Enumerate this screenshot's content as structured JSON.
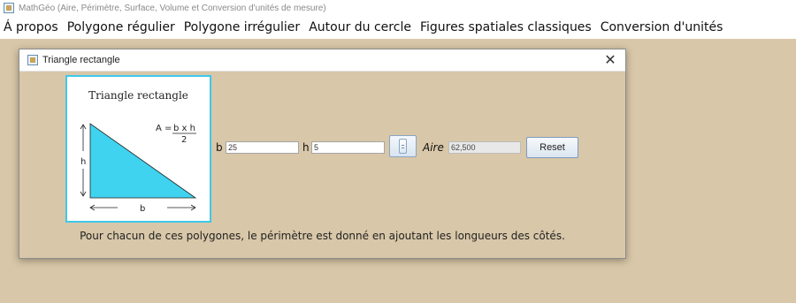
{
  "app": {
    "title": "MathGéo (Aire, Périmètre, Surface, Volume et Conversion d'unités de mesure)"
  },
  "menu": [
    {
      "label": "Á propos"
    },
    {
      "label": "Polygone régulier"
    },
    {
      "label": "Polygone irrégulier"
    },
    {
      "label": "Autour du cercle"
    },
    {
      "label": "Figures spatiales classiques"
    },
    {
      "label": "Conversion d'unités"
    }
  ],
  "dialog": {
    "title": "Triangle rectangle",
    "close_symbol": "✕",
    "figure": {
      "title": "Triangle rectangle",
      "formula_lhs": "A = ",
      "formula_num": "b x h",
      "formula_den": "2",
      "label_h": "h",
      "label_b": "b",
      "fill_color": "#3fd3ef"
    },
    "fields": {
      "b_label": "b",
      "b_value": "25",
      "h_label": "h",
      "h_value": "5",
      "aire_label": "Aire",
      "aire_value": "62,500"
    },
    "reset_label": "Reset",
    "footnote": "Pour chacun de ces polygones, le périmètre est donné en ajoutant les longueurs des côtés."
  },
  "colors": {
    "background": "#d8c7a8",
    "panel_border": "#3ec8ea"
  }
}
